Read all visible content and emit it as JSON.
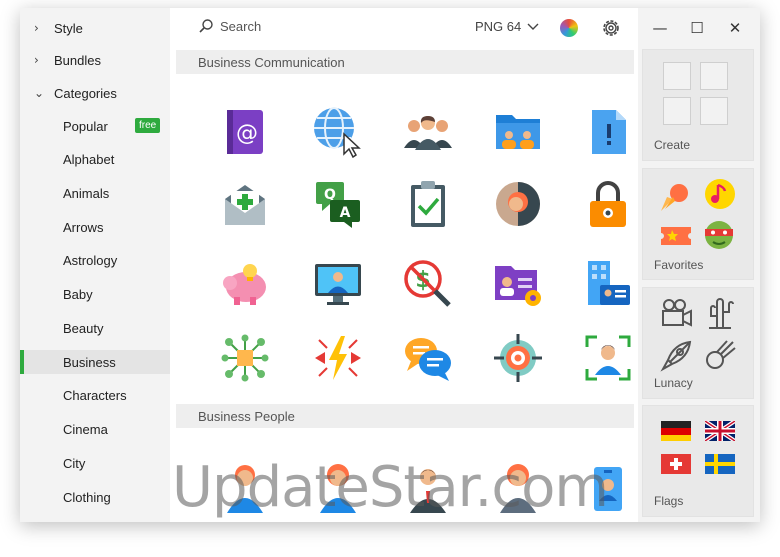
{
  "sidebar": {
    "top_items": [
      {
        "label": "Style",
        "chevron": "›"
      },
      {
        "label": "Bundles",
        "chevron": "›"
      },
      {
        "label": "Categories",
        "chevron": "⌄"
      }
    ],
    "categories": [
      {
        "label": "Popular"
      },
      {
        "label": "Alphabet"
      },
      {
        "label": "Animals"
      },
      {
        "label": "Arrows"
      },
      {
        "label": "Astrology"
      },
      {
        "label": "Baby"
      },
      {
        "label": "Beauty"
      },
      {
        "label": "Business"
      },
      {
        "label": "Characters"
      },
      {
        "label": "Cinema"
      },
      {
        "label": "City"
      },
      {
        "label": "Clothing"
      }
    ],
    "popular_badge": "free",
    "active_category": "Business"
  },
  "toolbar": {
    "search_placeholder": "Search",
    "format_label": "PNG 64",
    "icons": [
      "search-icon",
      "chevron-down-icon",
      "color-wheel-icon",
      "gear-icon"
    ]
  },
  "sections": [
    {
      "title": "Business Communication"
    },
    {
      "title": "Business People"
    }
  ],
  "window_controls": {
    "minimize": "—",
    "maximize": "☐",
    "close": "✕"
  },
  "cards": {
    "create": "Create",
    "favorites": "Favorites",
    "lunacy": "Lunacy",
    "flags": "Flags"
  },
  "watermark": "UpdateStar.com",
  "colors": {
    "accent": "#2eaa3e",
    "background": "#f3f3f3"
  }
}
